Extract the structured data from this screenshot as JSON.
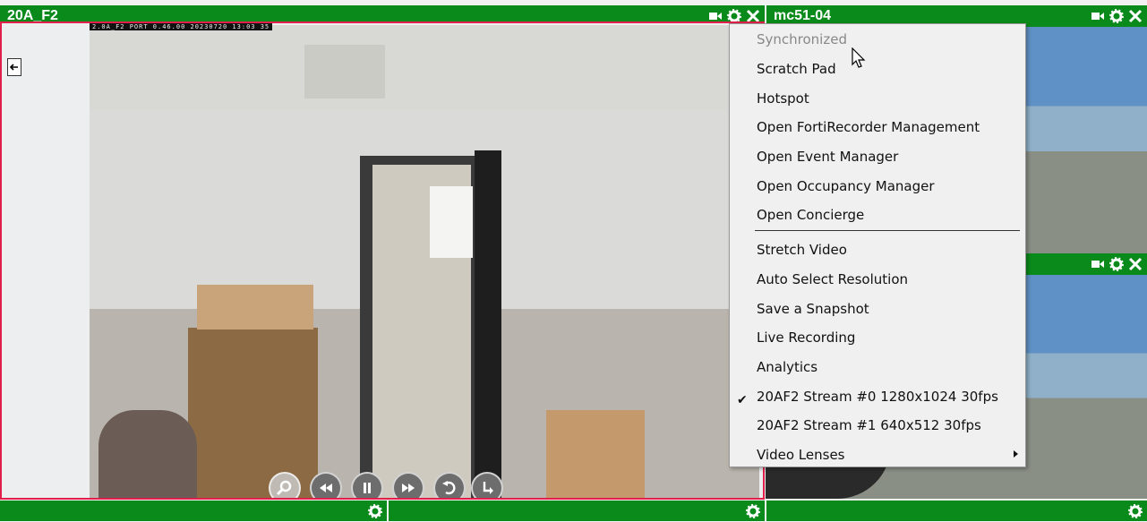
{
  "main_panel": {
    "title": "20A_F2",
    "overlay_text": "2.0A_F2   PORT   0.46.00  20230720 13:03 35",
    "controls": [
      "zoom-icon",
      "rewind-icon",
      "pause-icon",
      "fast-forward-icon",
      "replay-icon",
      "step-icon"
    ]
  },
  "right_top_panel": {
    "title": "mc51-04"
  },
  "context_menu": {
    "items": [
      {
        "label": "Synchronized",
        "disabled": true
      },
      {
        "label": "Scratch Pad"
      },
      {
        "label": "Hotspot"
      },
      {
        "label": "Open FortiRecorder Management"
      },
      {
        "label": "Open Event Manager"
      },
      {
        "label": "Open Occupancy Manager"
      },
      {
        "label": "Open Concierge"
      },
      {
        "label": "Stretch Video"
      },
      {
        "label": "Auto Select Resolution"
      },
      {
        "label": "Save a Snapshot"
      },
      {
        "label": "Live Recording"
      },
      {
        "label": "Analytics"
      },
      {
        "label": "20AF2 Stream #0 1280x1024 30fps",
        "checked": true
      },
      {
        "label": "20AF2 Stream #1 640x512 30fps"
      },
      {
        "label": "Video Lenses",
        "has_submenu": true
      }
    ]
  },
  "colors": {
    "bar_green": "#0a8a1a",
    "selected_border": "#e0204a"
  }
}
